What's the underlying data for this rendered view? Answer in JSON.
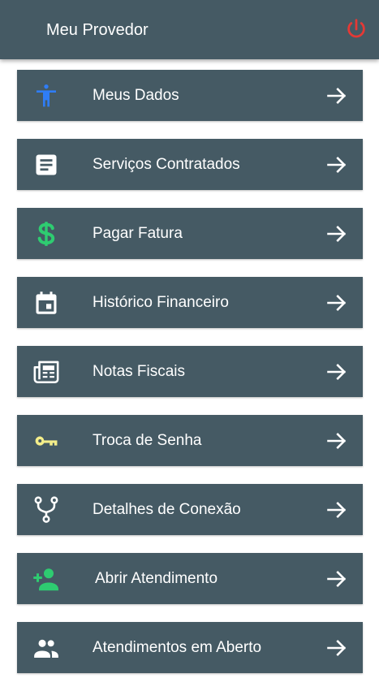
{
  "header": {
    "title": "Meu Provedor",
    "logout_icon": "power-icon",
    "logout_color": "#e53935"
  },
  "menu": {
    "items": [
      {
        "label": "Meus Dados",
        "icon": "person-icon",
        "icon_color": "#2f7df6"
      },
      {
        "label": "Serviços Contratados",
        "icon": "document-icon",
        "icon_color": "#ffffff"
      },
      {
        "label": "Pagar Fatura",
        "icon": "dollar-icon",
        "icon_color": "#2ecc71"
      },
      {
        "label": "Histórico Financeiro",
        "icon": "calendar-icon",
        "icon_color": "#ffffff"
      },
      {
        "label": "Notas Fiscais",
        "icon": "newspaper-icon",
        "icon_color": "#ffffff"
      },
      {
        "label": "Troca de Senha",
        "icon": "key-icon",
        "icon_color": "#f4ee8a"
      },
      {
        "label": "Detalhes de Conexão",
        "icon": "connection-icon",
        "icon_color": "#ffffff"
      },
      {
        "label": "Abrir Atendimento",
        "icon": "add-person-icon",
        "icon_color": "#2ecc71"
      },
      {
        "label": "Atendimentos em Aberto",
        "icon": "people-icon",
        "icon_color": "#ffffff"
      }
    ],
    "arrow_icon": "arrow-right-icon"
  },
  "colors": {
    "primary": "#455a64",
    "background": "#ffffff"
  }
}
